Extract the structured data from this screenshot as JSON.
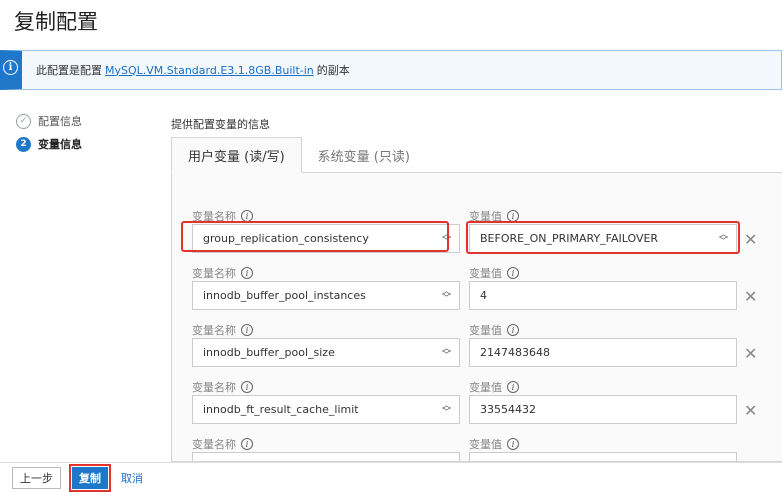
{
  "page": {
    "title": "复制配置"
  },
  "banner": {
    "text_before": "此配置是配置",
    "link_text": "MySQL.VM.Standard.E3.1.8GB.Built-in",
    "text_after": "的副本",
    "icon": "info-icon"
  },
  "steps": [
    {
      "label": "配置信息",
      "state": "done",
      "marker": "✓"
    },
    {
      "label": "变量信息",
      "state": "active",
      "marker": "2"
    }
  ],
  "section": {
    "heading": "提供配置变量的信息"
  },
  "tabs": [
    {
      "label": "用户变量 (读/写)",
      "active": true
    },
    {
      "label": "系统变量 (只读)",
      "active": false
    }
  ],
  "variables": {
    "name_label": "变量名称",
    "value_label": "变量值",
    "rows": [
      {
        "name": "group_replication_consistency",
        "value": "BEFORE_ON_PRIMARY_FAILOVER",
        "value_is_select": true,
        "highlighted": true
      },
      {
        "name": "innodb_buffer_pool_instances",
        "value": "4",
        "value_is_select": false,
        "highlighted": false
      },
      {
        "name": "innodb_buffer_pool_size",
        "value": "2147483648",
        "value_is_select": false,
        "highlighted": false
      },
      {
        "name": "innodb_ft_result_cache_limit",
        "value": "33554432",
        "value_is_select": false,
        "highlighted": false
      },
      {
        "name": "",
        "value": "",
        "value_is_select": false,
        "highlighted": false
      }
    ]
  },
  "footer": {
    "back_label": "上一步",
    "copy_label": "复制",
    "cancel_label": "取消"
  },
  "colors": {
    "accent": "#1f77c9",
    "highlight": "#e0342f",
    "link": "#1a6fc7"
  }
}
